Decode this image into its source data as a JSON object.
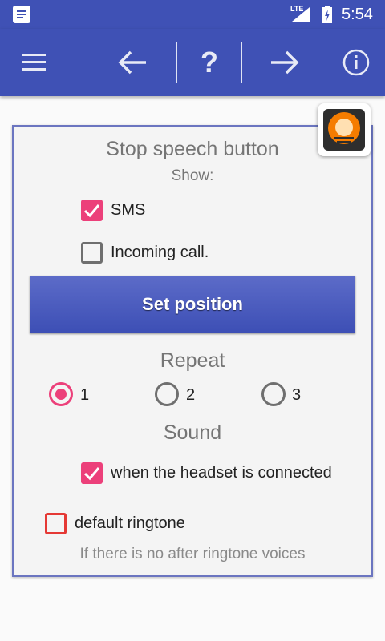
{
  "status_bar": {
    "network_type": "LTE",
    "time": "5:54",
    "icons": [
      "notification-icon",
      "signal-icon",
      "battery-icon"
    ]
  },
  "toolbar": {
    "icons": [
      "menu-icon",
      "arrow-left-icon",
      "help-icon",
      "arrow-right-icon",
      "info-icon"
    ],
    "help_label": "?"
  },
  "section": {
    "title": "Stop speech button",
    "show_label": "Show:"
  },
  "show_options": [
    {
      "label": "SMS",
      "checked": true
    },
    {
      "label": "Incoming call.",
      "checked": false
    }
  ],
  "set_position_button": "Set position",
  "repeat": {
    "title": "Repeat",
    "options": [
      "1",
      "2",
      "3"
    ],
    "selected": "1"
  },
  "sound": {
    "title": "Sound",
    "headset_label": "when the headset is connected",
    "headset_checked": true,
    "ringtone_label": "default ringtone",
    "ringtone_checked": false,
    "note": "If there is no after ringtone voices"
  },
  "colors": {
    "primary": "#3f51b5",
    "accent": "#ec407a",
    "unchecked_border": "#e53935"
  }
}
